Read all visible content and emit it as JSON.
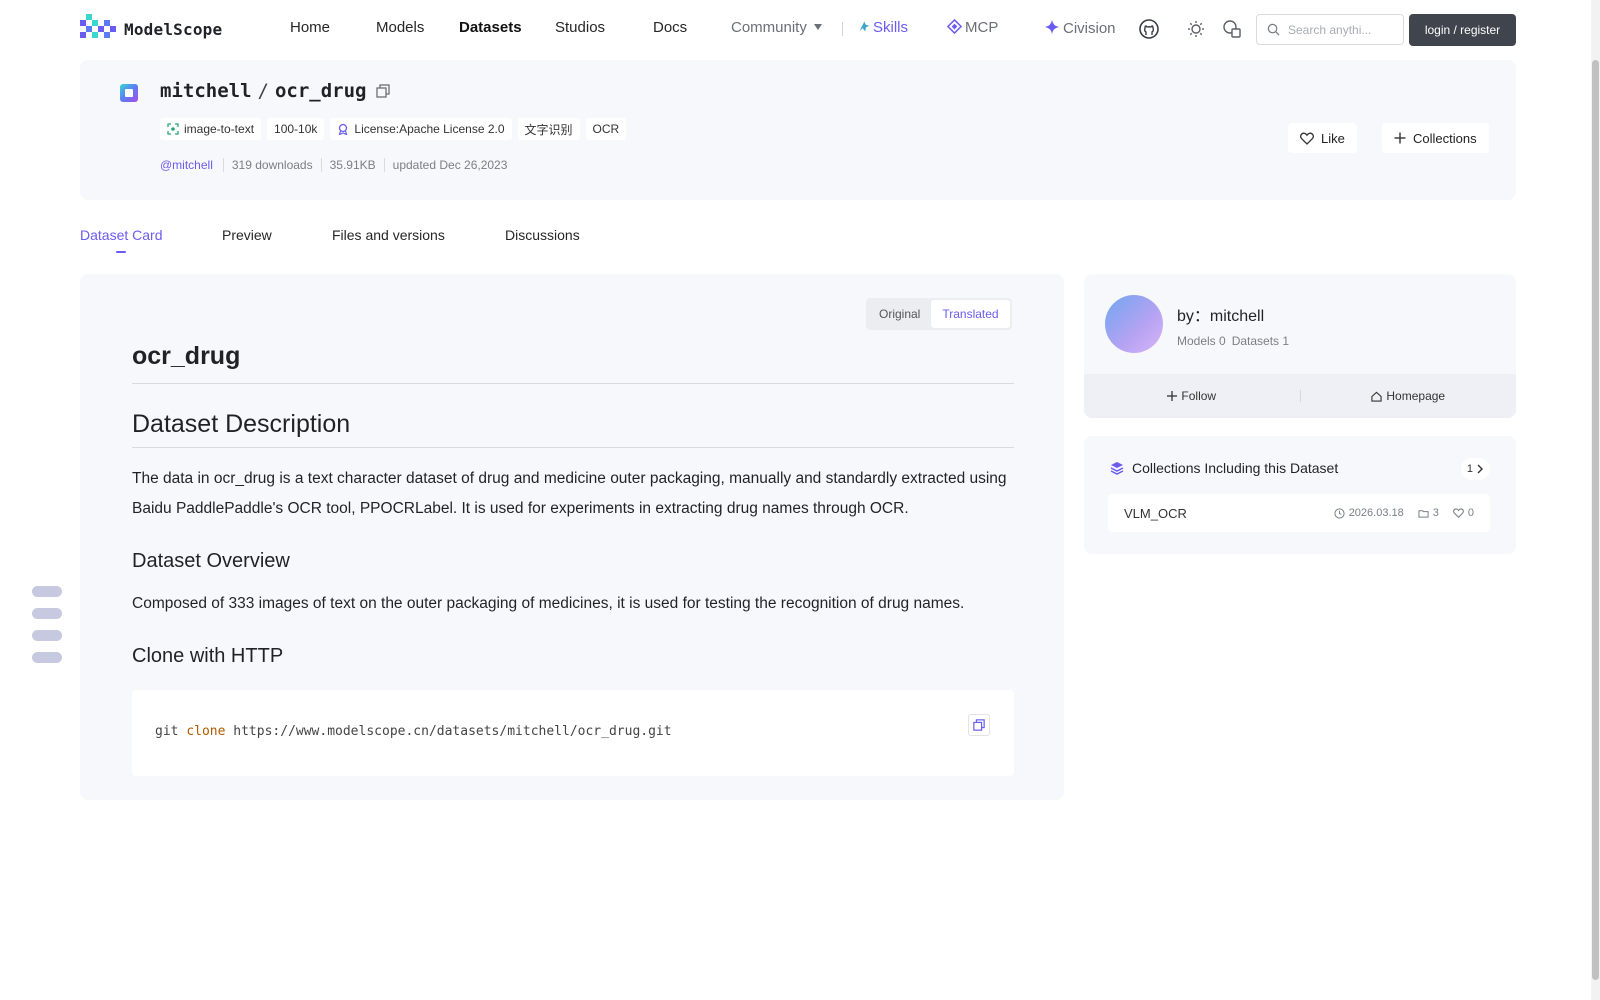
{
  "nav": {
    "logo_text": "ModelScope",
    "items": [
      "Home",
      "Models",
      "Datasets",
      "Studios",
      "Docs"
    ],
    "community": "Community",
    "skills": "Skills",
    "mcp": "MCP",
    "civision": "Civision",
    "search_placeholder": "Search anythi...",
    "login": "login / register"
  },
  "dataset": {
    "owner": "mitchell",
    "slash": "/",
    "name": "ocr_drug",
    "tags": [
      "image-to-text",
      "100-10k",
      "License:Apache License 2.0",
      "文字识别",
      "OCR"
    ],
    "author_handle": "@mitchell",
    "downloads": "319 downloads",
    "size": "35.91KB",
    "updated": "updated Dec 26,2023",
    "like": "Like",
    "collections": "Collections"
  },
  "tabs": [
    "Dataset Card",
    "Preview",
    "Files and versions",
    "Discussions"
  ],
  "card": {
    "toggle_original": "Original",
    "toggle_translated": "Translated",
    "title": "ocr_drug",
    "h_description": "Dataset Description",
    "description": "The data in ocr_drug is a text character dataset of drug and medicine outer packaging, manually and standardly extracted using Baidu PaddlePaddle's OCR tool, PPOCRLabel. It is used for experiments in extracting drug names through OCR.",
    "h_overview": "Dataset Overview",
    "overview": "Composed of 333 images of text on the outer packaging of medicines, it is used for testing the recognition of drug names.",
    "h_clone": "Clone with HTTP",
    "clone_cmd": "git",
    "clone_kw": "clone",
    "clone_url": "https://www.modelscope.cn/datasets/mitchell/ocr_drug.git"
  },
  "author": {
    "by": "by：mitchell",
    "models": "Models 0",
    "datasets": "Datasets 1",
    "follow": "Follow",
    "homepage": "Homepage"
  },
  "collections_panel": {
    "title": "Collections Including this Dataset",
    "count": "1",
    "item_name": "VLM_OCR",
    "item_date": "2026.03.18",
    "item_count": "3",
    "item_likes": "0"
  },
  "colors": {
    "accent": "#6a5cf0",
    "card_bg": "#f7f8fb",
    "login_bg": "#3f444d"
  }
}
